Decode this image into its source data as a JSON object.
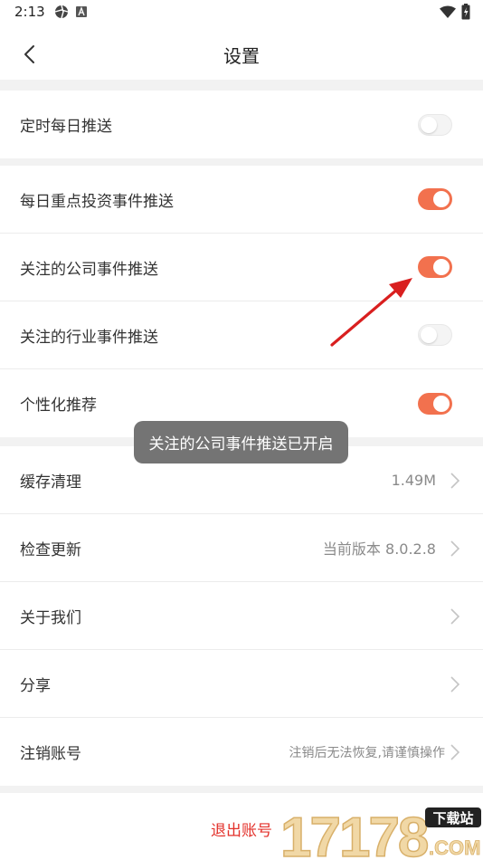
{
  "status_bar": {
    "time": "2:13"
  },
  "nav": {
    "title": "设置"
  },
  "sections": {
    "timed_push": {
      "label": "定时每日推送",
      "state": "off"
    },
    "push": [
      {
        "label": "每日重点投资事件推送",
        "state": "on"
      },
      {
        "label": "关注的公司事件推送",
        "state": "on"
      },
      {
        "label": "关注的行业事件推送",
        "state": "off"
      },
      {
        "label": "个性化推荐",
        "state": "on"
      }
    ],
    "general": [
      {
        "label": "缓存清理",
        "value": "1.49M"
      },
      {
        "label": "检查更新",
        "value": "当前版本 8.0.2.8"
      },
      {
        "label": "关于我们",
        "value": ""
      },
      {
        "label": "分享",
        "value": ""
      },
      {
        "label": "注销账号",
        "value": "注销后无法恢复,请谨慎操作"
      }
    ]
  },
  "toast": {
    "text": "关注的公司事件推送已开启"
  },
  "logout": {
    "label": "退出账号"
  },
  "watermark": {
    "main": "17178",
    "badge": "下载站",
    "sub": ".COM"
  },
  "colors": {
    "accent": "#f2714e",
    "danger": "#e3312b",
    "arrow": "#d91f1f"
  }
}
